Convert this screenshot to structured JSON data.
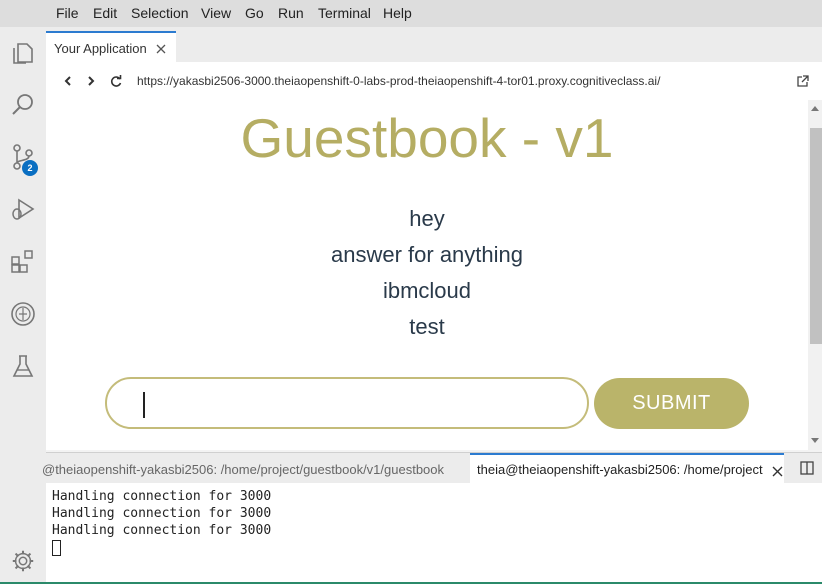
{
  "menu": [
    "File",
    "Edit",
    "Selection",
    "View",
    "Go",
    "Run",
    "Terminal",
    "Help"
  ],
  "activity_bar": {
    "icons": [
      "explorer-icon",
      "search-icon",
      "source-control-icon",
      "debug-icon",
      "extensions-icon",
      "openshift-icon",
      "test-icon",
      "gear-icon"
    ],
    "scm_badge": "2"
  },
  "tab": {
    "label": "Your Application"
  },
  "browser": {
    "url": "https://yakasbi2506-3000.theiaopenshift-0-labs-prod-theiaopenshift-4-tor01.proxy.cognitiveclass.ai/"
  },
  "guestbook": {
    "title": "Guestbook - v1",
    "entries": [
      "hey",
      "answer for anything",
      "ibmcloud",
      "test"
    ],
    "input_value": "",
    "submit_label": "SUBMIT",
    "accent_color": "#b5ad63"
  },
  "terminal": {
    "tab1_label": "@theiaopenshift-yakasbi2506: /home/project/guestbook/v1/guestbook",
    "tab2_label": "theia@theiaopenshift-yakasbi2506: /home/project",
    "lines": [
      "Handling connection for 3000",
      "Handling connection for 3000",
      "Handling connection for 3000"
    ]
  }
}
